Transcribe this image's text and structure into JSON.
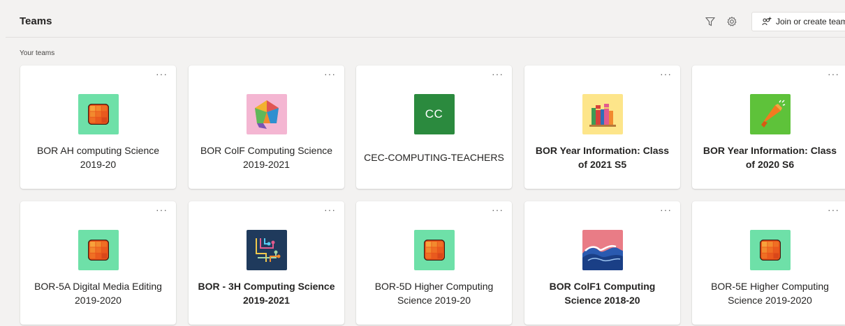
{
  "header": {
    "title": "Teams",
    "join_label": "Join or create team"
  },
  "section": {
    "label": "Your teams"
  },
  "more_label": "···",
  "colors": {
    "background": "#f3f2f1",
    "card": "#ffffff",
    "mint": "#6ee0a8",
    "cc_green": "#2b8a3e"
  },
  "teams": [
    {
      "name": "BOR AH computing Science 2019-20",
      "icon": "orange-grid-icon",
      "bold": false
    },
    {
      "name": "BOR ColF Computing Science 2019-2021",
      "icon": "dodecahedron-icon",
      "bold": false
    },
    {
      "name": "CEC-COMPUTING-TEACHERS",
      "icon": "initials-icon",
      "initials": "CC",
      "bold": false
    },
    {
      "name": "BOR Year Information: Class of 2021 S5",
      "icon": "books-icon",
      "bold": true
    },
    {
      "name": "BOR Year Information: Class of 2020 S6",
      "icon": "megaphone-icon",
      "bold": true
    },
    {
      "name": "BOR-5A Digital Media Editing 2019-2020",
      "icon": "orange-grid-icon",
      "bold": false
    },
    {
      "name": "BOR - 3H Computing Science 2019-2021",
      "icon": "circuit-icon",
      "bold": true
    },
    {
      "name": "BOR-5D Higher Computing Science 2019-20",
      "icon": "orange-grid-icon",
      "bold": false
    },
    {
      "name": "BOR ColF1 Computing Science 2018-20",
      "icon": "wave-icon",
      "bold": true
    },
    {
      "name": "BOR-5E Higher Computing Science 2019-2020",
      "icon": "orange-grid-icon",
      "bold": false
    }
  ]
}
